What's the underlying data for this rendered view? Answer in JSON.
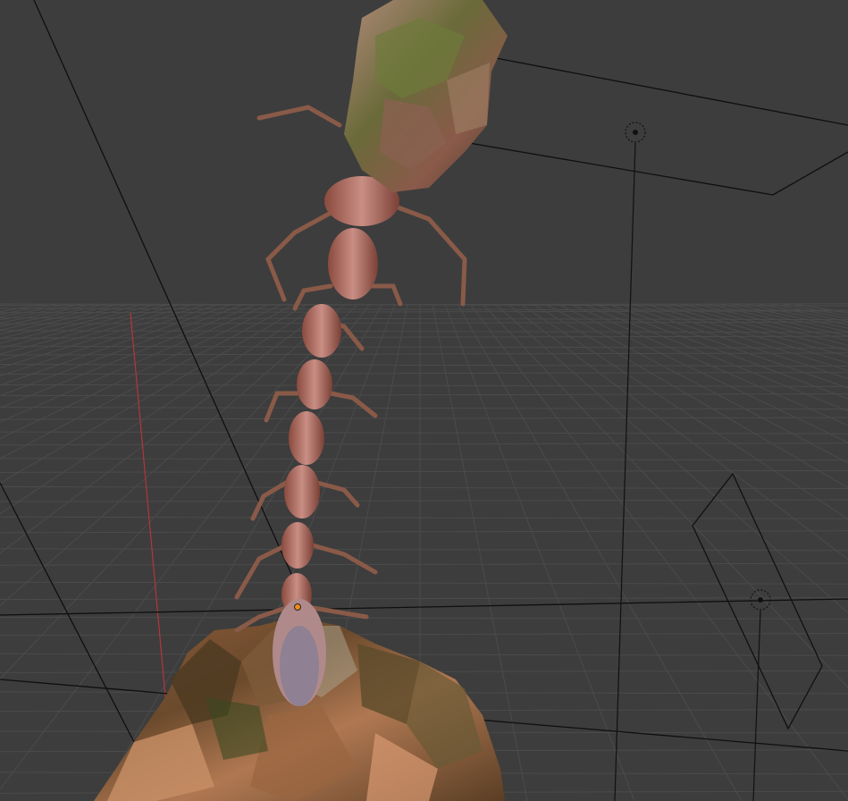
{
  "viewport": {
    "background": "#3d3d3d",
    "grid_color": "#4a4a4a",
    "x_axis_color": "#c0383f",
    "line_color": "#0d0d0d"
  },
  "objects": {
    "creature": {
      "kind": "centipede-like creature mesh"
    },
    "rock": {
      "kind": "rock mesh"
    },
    "light_top": {
      "kind": "point light"
    },
    "light_right": {
      "kind": "point light"
    },
    "camera": {
      "kind": "camera"
    },
    "origin": {
      "kind": "selected object origin"
    }
  }
}
